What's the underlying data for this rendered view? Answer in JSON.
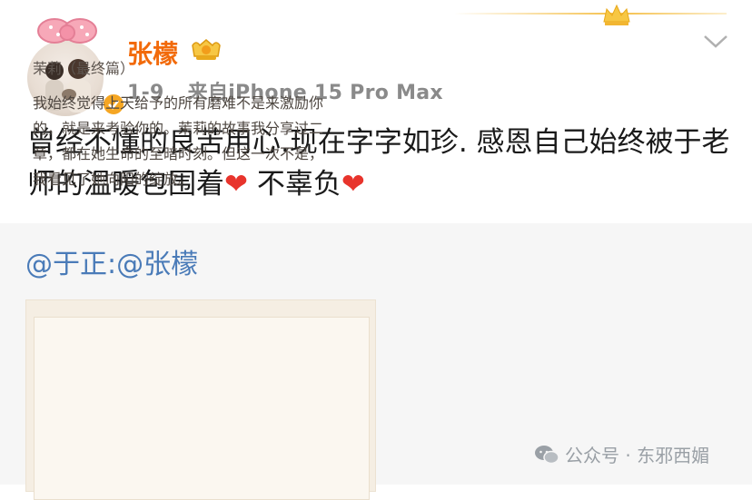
{
  "post": {
    "username": "张檬",
    "date": "1-9",
    "source": "来自iPhone 15 Pro Max",
    "text_part1": "曾经不懂的良苦用心.现在字字如珍. 感恩自己始终被于老师的温暖包围着",
    "text_part2": "不辜负",
    "heart": "❤"
  },
  "repost": {
    "mention": "@于正:@张檬",
    "card_title": "茉莉（最终篇）",
    "card_body": "我始终觉得上天给予的所有磨难不是来激励你的，就是来考验你的。茉莉的故事我分享过二章，都在她生命的至暗时刻。但这一次不是，我看见了她向阳的绽放。"
  },
  "watermark": {
    "text": "公众号 · 东邪西媚"
  },
  "colors": {
    "username": "#f26a0a",
    "mention": "#4a7bb8",
    "heart": "#e8342c"
  },
  "icons": [
    "crown-icon",
    "bow-icon",
    "verified-icon",
    "vip-icon",
    "chevron-down-icon",
    "wechat-icon"
  ]
}
